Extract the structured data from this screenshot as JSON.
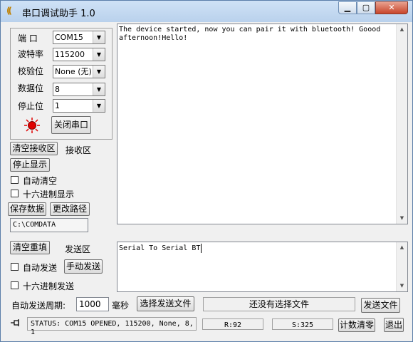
{
  "window": {
    "title": "串口调试助手 1.0",
    "icon": "app-logo-icon",
    "min": "▁",
    "max": "▢",
    "close": "✕"
  },
  "serial": {
    "port_label": "端 口",
    "port_value": "COM15",
    "baud_label": "波特率",
    "baud_value": "115200",
    "parity_label": "校验位",
    "parity_value": "None (无)",
    "databits_label": "数据位",
    "databits_value": "8",
    "stopbits_label": "停止位",
    "stopbits_value": "1",
    "close_port": "关闭串口"
  },
  "receive": {
    "clear_button": "清空接收区",
    "area_label": "接收区",
    "stop_display": "停止显示",
    "auto_clear": "自动清空",
    "hex_display": "十六进制显示",
    "save_data": "保存数据",
    "change_path": "更改路径",
    "path": "C:\\COMDATA",
    "text": "The device started, now you can pair it with bluetooth! Goood afternoon!Hello!"
  },
  "send": {
    "clear_button": "清空重填",
    "area_label": "发送区",
    "auto_send": "自动发送",
    "manual_send": "手动发送",
    "hex_send": "十六进制发送",
    "text": "Serial To Serial BT",
    "period_label": "自动发送周期:",
    "period_value": "1000",
    "period_unit": "毫秒",
    "select_file": "选择发送文件",
    "file_status": "还没有选择文件",
    "send_file": "发送文件"
  },
  "status": {
    "text": "STATUS: COM15 OPENED, 115200, None, 8, 1",
    "rx": "R:92",
    "tx": "S:325",
    "reset_count": "计数清零",
    "exit": "退出"
  },
  "colors": {
    "indicator": "#e00000"
  }
}
